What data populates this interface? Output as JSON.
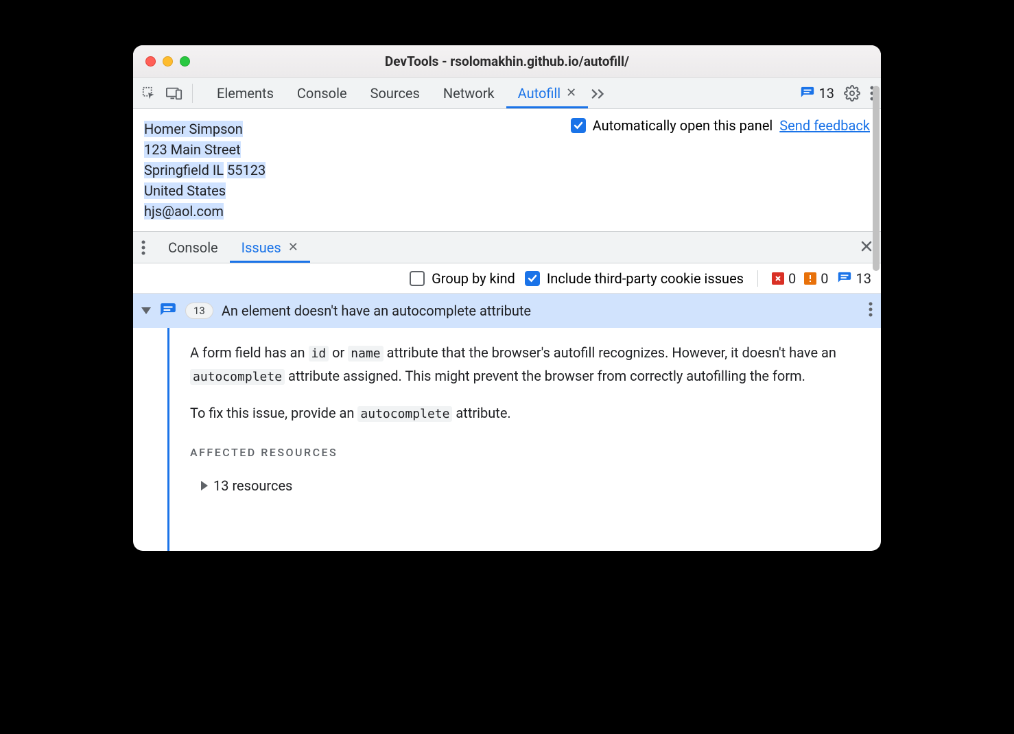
{
  "window": {
    "title": "DevTools - rsolomakhin.github.io/autofill/"
  },
  "toolbar": {
    "tabs": [
      "Elements",
      "Console",
      "Sources",
      "Network",
      "Autofill"
    ],
    "active_tab": "Autofill",
    "message_count": "13"
  },
  "autofill_panel": {
    "contact_name": "Homer Simpson",
    "address_line": "123 Main Street",
    "city_line_parts": {
      "city": "Springfield",
      "state_prefix": "IL",
      "zip": "55123"
    },
    "country": "United States",
    "email": "hjs@aol.com",
    "auto_open_label": "Automatically open this panel",
    "feedback_link": "Send feedback"
  },
  "drawer": {
    "tabs": [
      "Console",
      "Issues"
    ],
    "active_tab": "Issues",
    "group_by_kind_label": "Group by kind",
    "include_third_party_label": "Include third-party cookie issues",
    "counts": {
      "error": "0",
      "warning": "0",
      "info": "13"
    }
  },
  "issue": {
    "count": "13",
    "title": "An element doesn't have an autocomplete attribute",
    "body_p1_parts": {
      "a": "A form field has an ",
      "code1": "id",
      "b": " or ",
      "code2": "name",
      "c": " attribute that the browser's autofill recognizes. However, it doesn't have an ",
      "code3": "autocomplete",
      "d": " attribute assigned. This might prevent the browser from correctly autofilling the form."
    },
    "body_p2_parts": {
      "a": "To fix this issue, provide an ",
      "code1": "autocomplete",
      "b": " attribute."
    },
    "affected_heading": "AFFECTED RESOURCES",
    "resources_label": "13 resources"
  }
}
